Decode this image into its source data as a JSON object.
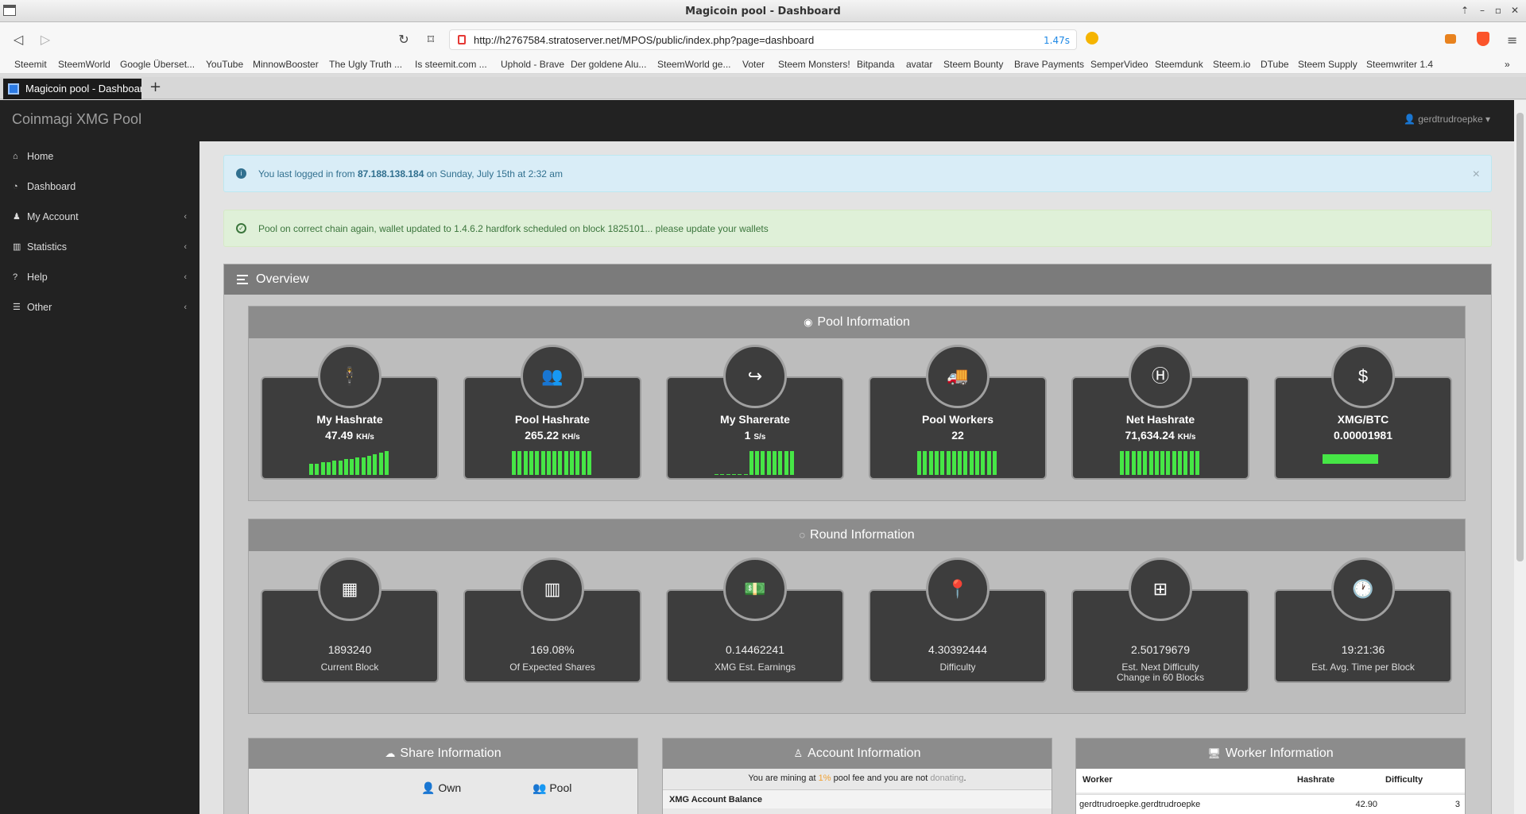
{
  "window": {
    "title": "Magicoin pool - Dashboard"
  },
  "browser": {
    "url": "http://h2767584.stratoserver.net/MPOS/public/index.php?page=dashboard",
    "load_time": "1.47s",
    "tab_title": "Magicoin pool - Dashboard",
    "bookmarks": [
      "Steemit",
      "SteemWorld",
      "Google Überset...",
      "YouTube",
      "MinnowBooster",
      "The Ugly Truth ...",
      "Is steemit.com ...",
      "Uphold - Brave",
      "Der goldene Alu...",
      "SteemWorld ge...",
      "Voter",
      "Steem Monsters!",
      "Bitpanda",
      "avatar",
      "Steem Bounty",
      "Brave Payments",
      "SemperVideo",
      "Steemdunk",
      "Steem.io",
      "DTube",
      "Steem Supply",
      "Steemwriter 1.4"
    ]
  },
  "navbar": {
    "brand": "Coinmagi XMG Pool",
    "user": "gerdtrudroepke"
  },
  "sidebar": {
    "items": [
      {
        "label": "Home",
        "icon": "home-icon"
      },
      {
        "label": "Dashboard",
        "icon": "dashboard-icon"
      },
      {
        "label": "My Account",
        "icon": "user-icon"
      },
      {
        "label": "Statistics",
        "icon": "bar-chart-icon"
      },
      {
        "label": "Help",
        "icon": "question-icon"
      },
      {
        "label": "Other",
        "icon": "list-icon"
      }
    ]
  },
  "alerts": {
    "login": {
      "prefix": "You last logged in from ",
      "ip": "87.188.138.184",
      "suffix": " on Sunday, July 15th at 2:32 am"
    },
    "chain": "Pool on correct chain again, wallet updated to 1.4.6.2 hardfork scheduled on block 1825101... please update your wallets"
  },
  "overview": {
    "title": "Overview"
  },
  "pool_info": {
    "title": "Pool Information",
    "cards": [
      {
        "label": "My Hashrate",
        "value": "47.49",
        "unit": "KH/s",
        "icon": "male-icon"
      },
      {
        "label": "Pool Hashrate",
        "value": "265.22",
        "unit": "KH/s",
        "icon": "users-icon"
      },
      {
        "label": "My Sharerate",
        "value": "1",
        "unit": "S/s",
        "icon": "share-icon"
      },
      {
        "label": "Pool Workers",
        "value": "22",
        "unit": "",
        "icon": "truck-icon"
      },
      {
        "label": "Net Hashrate",
        "value": "71,634.24",
        "unit": "KH/s",
        "icon": "h-square-icon"
      },
      {
        "label": "XMG/BTC",
        "value": "0.00001981",
        "unit": "",
        "icon": "dollar-icon"
      }
    ]
  },
  "round_info": {
    "title": "Round Information",
    "cards": [
      {
        "value": "1893240",
        "label": "Current Block",
        "icon": "th-large-icon"
      },
      {
        "value": "169.08%",
        "label": "Of Expected Shares",
        "icon": "bar-chart-icon"
      },
      {
        "value": "0.14462241",
        "label": "XMG Est. Earnings",
        "icon": "money-icon"
      },
      {
        "value": "4.30392444",
        "label": "Difficulty",
        "icon": "map-marker-icon"
      },
      {
        "value": "2.50179679",
        "label": "Est. Next Difficulty",
        "label2": "Change in 60 Blocks",
        "icon": "sitemap-icon"
      },
      {
        "value": "19:21:36",
        "label": "Est. Avg. Time per Block",
        "icon": "clock-icon"
      }
    ]
  },
  "share_info": {
    "title": "Share Information",
    "col_own": "Own",
    "col_pool": "Pool"
  },
  "account_info": {
    "title": "Account Information",
    "mining_prefix": "You are mining at ",
    "fee": "1%",
    "mining_mid": " pool fee and you are not ",
    "donating": "donating",
    "mining_suffix": ".",
    "balance_label": "XMG Account Balance"
  },
  "worker_info": {
    "title": "Worker Information",
    "columns": [
      "Worker",
      "Hashrate",
      "Difficulty"
    ],
    "rows": [
      {
        "worker": "gerdtrudroepke.gerdtrudroepke",
        "hashrate": "42.90",
        "difficulty": "3"
      }
    ]
  },
  "colors": {
    "accent_green": "#46e646",
    "navbar": "#222222",
    "alert_info": "#d9edf7",
    "alert_success": "#dff0d8",
    "fee_orange": "#f0a030"
  }
}
